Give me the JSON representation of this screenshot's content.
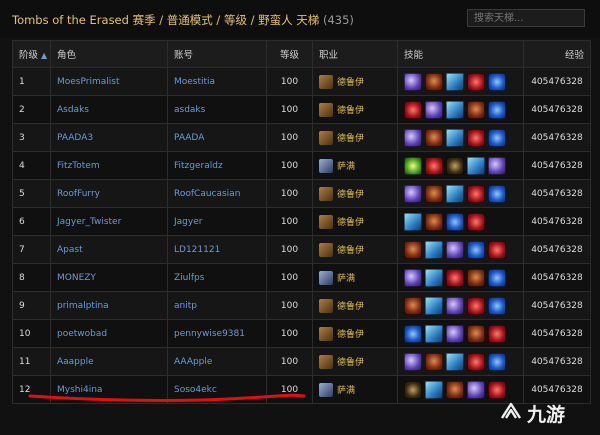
{
  "header": {
    "title": "Tombs of the Erased 赛季 / 普通模式 / 等级 / 野蛮人 天梯",
    "count": "(435)",
    "search_placeholder": "搜索天梯..."
  },
  "columns": {
    "rank": "阶级",
    "char": "角色",
    "account": "账号",
    "level": "等级",
    "class": "职业",
    "skills": "技能",
    "exp": "经验"
  },
  "class_names": {
    "druid": "德鲁伊",
    "shaman": "萨满"
  },
  "rows": [
    {
      "rank": "1",
      "char": "MoesPrimalist",
      "account": "Moestitia",
      "level": "100",
      "class": "druid",
      "class_label": "德鲁伊",
      "skills": [
        "sk-purple",
        "sk-bear",
        "sk-ice",
        "sk-red",
        "sk-swirl"
      ],
      "exp": "405476328"
    },
    {
      "rank": "2",
      "char": "Asdaks",
      "account": "asdaks",
      "level": "100",
      "class": "druid",
      "class_label": "德鲁伊",
      "skills": [
        "sk-red",
        "sk-purple",
        "sk-ice",
        "sk-bear",
        "sk-swirl"
      ],
      "exp": "405476328"
    },
    {
      "rank": "3",
      "char": "PAADA3",
      "account": "PAADA",
      "level": "100",
      "class": "druid",
      "class_label": "德鲁伊",
      "skills": [
        "sk-purple",
        "sk-bear",
        "sk-ice",
        "sk-red",
        "sk-swirl"
      ],
      "exp": "405476328"
    },
    {
      "rank": "4",
      "char": "FitzTotem",
      "account": "Fitzgeraldz",
      "level": "100",
      "class": "shaman",
      "class_label": "萨满",
      "skills": [
        "sk-green",
        "sk-red",
        "sk-dark",
        "sk-ice",
        "sk-purple"
      ],
      "exp": "405476328"
    },
    {
      "rank": "5",
      "char": "RoofFurry",
      "account": "RoofCaucasian",
      "level": "100",
      "class": "druid",
      "class_label": "德鲁伊",
      "skills": [
        "sk-purple",
        "sk-bear",
        "sk-ice",
        "sk-red",
        "sk-swirl"
      ],
      "exp": "405476328"
    },
    {
      "rank": "6",
      "char": "Jagyer_Twister",
      "account": "Jagyer",
      "level": "100",
      "class": "druid",
      "class_label": "德鲁伊",
      "skills": [
        "sk-ice",
        "sk-bear",
        "sk-swirl",
        "sk-red"
      ],
      "exp": "405476328"
    },
    {
      "rank": "7",
      "char": "Apast",
      "account": "LD121121",
      "level": "100",
      "class": "druid",
      "class_label": "德鲁伊",
      "skills": [
        "sk-bear",
        "sk-ice",
        "sk-purple",
        "sk-swirl",
        "sk-red"
      ],
      "exp": "405476328"
    },
    {
      "rank": "8",
      "char": "MONEZY",
      "account": "Ziulfps",
      "level": "100",
      "class": "shaman",
      "class_label": "萨满",
      "skills": [
        "sk-purple",
        "sk-ice",
        "sk-red",
        "sk-bear",
        "sk-swirl"
      ],
      "exp": "405476328"
    },
    {
      "rank": "9",
      "char": "primalptina",
      "account": "anitp",
      "level": "100",
      "class": "druid",
      "class_label": "德鲁伊",
      "skills": [
        "sk-bear",
        "sk-ice",
        "sk-purple",
        "sk-red",
        "sk-swirl"
      ],
      "exp": "405476328"
    },
    {
      "rank": "10",
      "char": "poetwobad",
      "account": "pennywise9381",
      "level": "100",
      "class": "druid",
      "class_label": "德鲁伊",
      "skills": [
        "sk-swirl",
        "sk-ice",
        "sk-purple",
        "sk-bear",
        "sk-red"
      ],
      "exp": "405476328"
    },
    {
      "rank": "11",
      "char": "Aaapple",
      "account": "AAApple",
      "level": "100",
      "class": "druid",
      "class_label": "德鲁伊",
      "skills": [
        "sk-purple",
        "sk-bear",
        "sk-ice",
        "sk-red",
        "sk-swirl"
      ],
      "exp": "405476328"
    },
    {
      "rank": "12",
      "char": "Myshi4ina",
      "account": "Soso4ekc",
      "level": "100",
      "class": "shaman",
      "class_label": "萨满",
      "skills": [
        "sk-dark",
        "sk-ice",
        "sk-bear",
        "sk-purple",
        "sk-red"
      ],
      "exp": "405476328"
    }
  ],
  "watermark": "九游",
  "colors": {
    "accent_gold": "#e7c06a",
    "link_blue": "#6a9bd6",
    "class_gold": "#e0b84c",
    "annotation_red": "#e01010"
  }
}
